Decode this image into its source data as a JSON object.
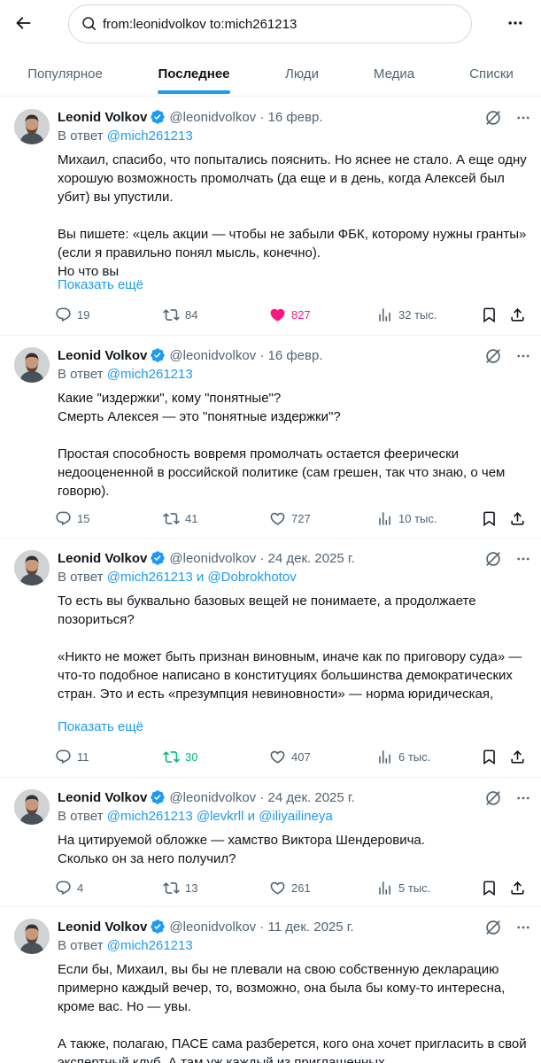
{
  "search": {
    "query": "from:leonidvolkov to:mich261213"
  },
  "tabs": [
    {
      "label": "Популярное"
    },
    {
      "label": "Последнее"
    },
    {
      "label": "Люди"
    },
    {
      "label": "Медиа"
    },
    {
      "label": "Списки"
    }
  ],
  "active_tab": "Последнее",
  "colors": {
    "accent": "#1d9bf0",
    "like": "#f91880",
    "repost": "#00ba7c",
    "secondary_text": "#536471"
  },
  "tweets": [
    {
      "name": "Leonid Volkov",
      "handle_date": "@leonidvolkov · 16 февр.",
      "reply_prefix": "В ответ",
      "reply_to": "@mich261213",
      "text": "Михаил, спасибо, что попытались пояснить. Но яснее не стало. А еще одну хорошую возможность промолчать (да еще и в день, когда Алексей был убит) вы упустили.\n\nВы пишете: «цель акции — чтобы не забыли ФБК, которому нужны гранты» (если я правильно понял мысль, конечно).\nНо что вы",
      "show_more": "Показать ещё",
      "replies": "19",
      "reposts": "84",
      "likes": "827",
      "views": "32 тыс.",
      "liked": true,
      "reposted": false
    },
    {
      "name": "Leonid Volkov",
      "handle_date": "@leonidvolkov · 16 февр.",
      "reply_prefix": "В ответ",
      "reply_to": "@mich261213",
      "text": "Какие \"издержки\", кому \"понятные\"?\nСмерть Алексея — это \"понятные издержки\"?\n\nПростая способность вовремя промолчать остается феерически недооцененной в российской политике (сам грешен, так что знаю, о чем говорю).",
      "replies": "15",
      "reposts": "41",
      "likes": "727",
      "views": "10 тыс.",
      "liked": false,
      "reposted": false
    },
    {
      "name": "Leonid Volkov",
      "handle_date": "@leonidvolkov · 24 дек. 2025 г.",
      "reply_prefix": "В ответ",
      "reply_to": "@mich261213 и @Dobrokhotov",
      "text": "То есть вы буквально базовых вещей не понимаете, а продолжаете позориться?\n\n«Никто не может быть признан виновным, иначе как по приговору суда» — что-то подобное написано в конституциях большинства демократических стран. Это и есть «презумпция невиновности» — норма юридическая,",
      "show_more": "Показать ещё",
      "replies": "11",
      "reposts": "30",
      "likes": "407",
      "views": "6 тыс.",
      "liked": false,
      "reposted": true
    },
    {
      "name": "Leonid Volkov",
      "handle_date": "@leonidvolkov · 24 дек. 2025 г.",
      "reply_prefix": "В ответ",
      "reply_to": "@mich261213 @levkrll и @iliyailineya",
      "text": "На цитируемой обложке — хамство Виктора Шендеровича.\nСколько он за него получил?",
      "replies": "4",
      "reposts": "13",
      "likes": "261",
      "views": "5 тыс.",
      "liked": false,
      "reposted": false
    },
    {
      "name": "Leonid Volkov",
      "handle_date": "@leonidvolkov · 11 дек. 2025 г.",
      "reply_prefix": "В ответ",
      "reply_to": "@mich261213",
      "text": "Если бы, Михаил, вы бы не плевали на свою собственную декларацию примерно каждый вечер, то, возможно, она была бы кому-то интересна, кроме вас. Но — увы.\n\nА также, полагаю, ПАСЕ сама разберется, кого она хочет пригласить в свой экспертный клуб. А там уж каждый из приглашенных"
    }
  ]
}
